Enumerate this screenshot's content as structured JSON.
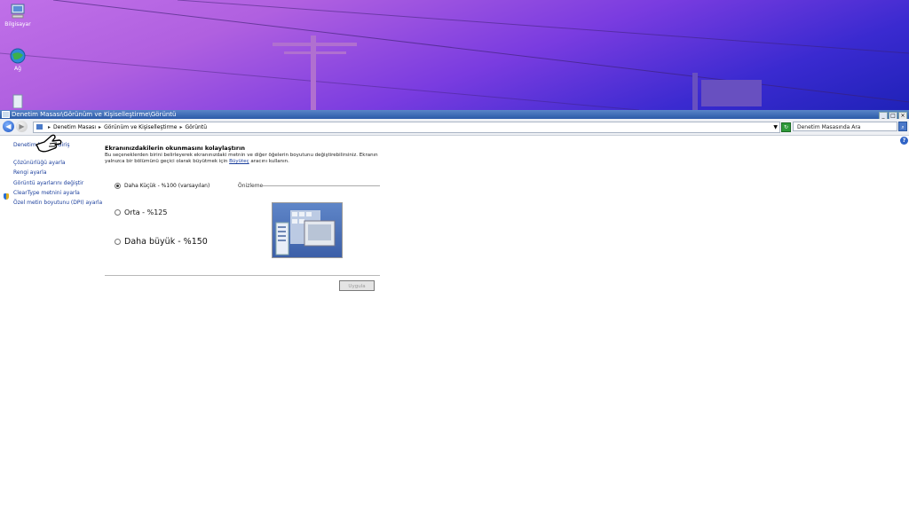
{
  "desktop": {
    "icons": [
      {
        "label": "Bilgisayar",
        "icon": "computer-icon"
      },
      {
        "label": "Ağ",
        "icon": "network-icon"
      },
      {
        "label": "",
        "icon": "recycle-bin-icon"
      }
    ]
  },
  "window": {
    "title": "Denetim Masası\\Görünüm ve Kişiselleştirme\\Görüntü",
    "controls": {
      "minimize": "_",
      "maximize": "□",
      "close": "×"
    }
  },
  "address": {
    "crumbs": [
      "Denetim Masası",
      "Görünüm ve Kişiselleştirme",
      "Görüntü"
    ],
    "search_placeholder": "Denetim Masasında Ara"
  },
  "sidebar": {
    "home": "Denetim Masası Giriş",
    "items": [
      "Çözünürlüğü ayarla",
      "Rengi ayarla",
      "Görüntü ayarlarını değiştir",
      "ClearType metnini ayarla",
      "Özel metin boyutunu (DPI) ayarla"
    ]
  },
  "main": {
    "heading": "Ekranınızdakilerin okunmasını kolaylaştırın",
    "description_before": "Bu seçeneklerden birini belirleyerek ekranınızdaki metnin ve diğer öğelerin boyutunu değiştirebilirsiniz. Ekranın yalnızca bir bölümünü geçici olarak büyütmek için",
    "description_link": "Büyüteç",
    "description_after": "aracını kullanın.",
    "options": [
      {
        "label": "Daha Küçük - %100 (varsayılan)",
        "selected": true
      },
      {
        "label": "Orta - %125",
        "selected": false
      },
      {
        "label": "Daha büyük - %150",
        "selected": false
      }
    ],
    "preview_label": "Önizleme",
    "apply_label": "Uygula"
  },
  "colors": {
    "titlebar": "#2b5aa8",
    "link": "#1a3e9c",
    "wallpaper_top": "#c070e8",
    "wallpaper_bottom": "#1f22b8"
  }
}
